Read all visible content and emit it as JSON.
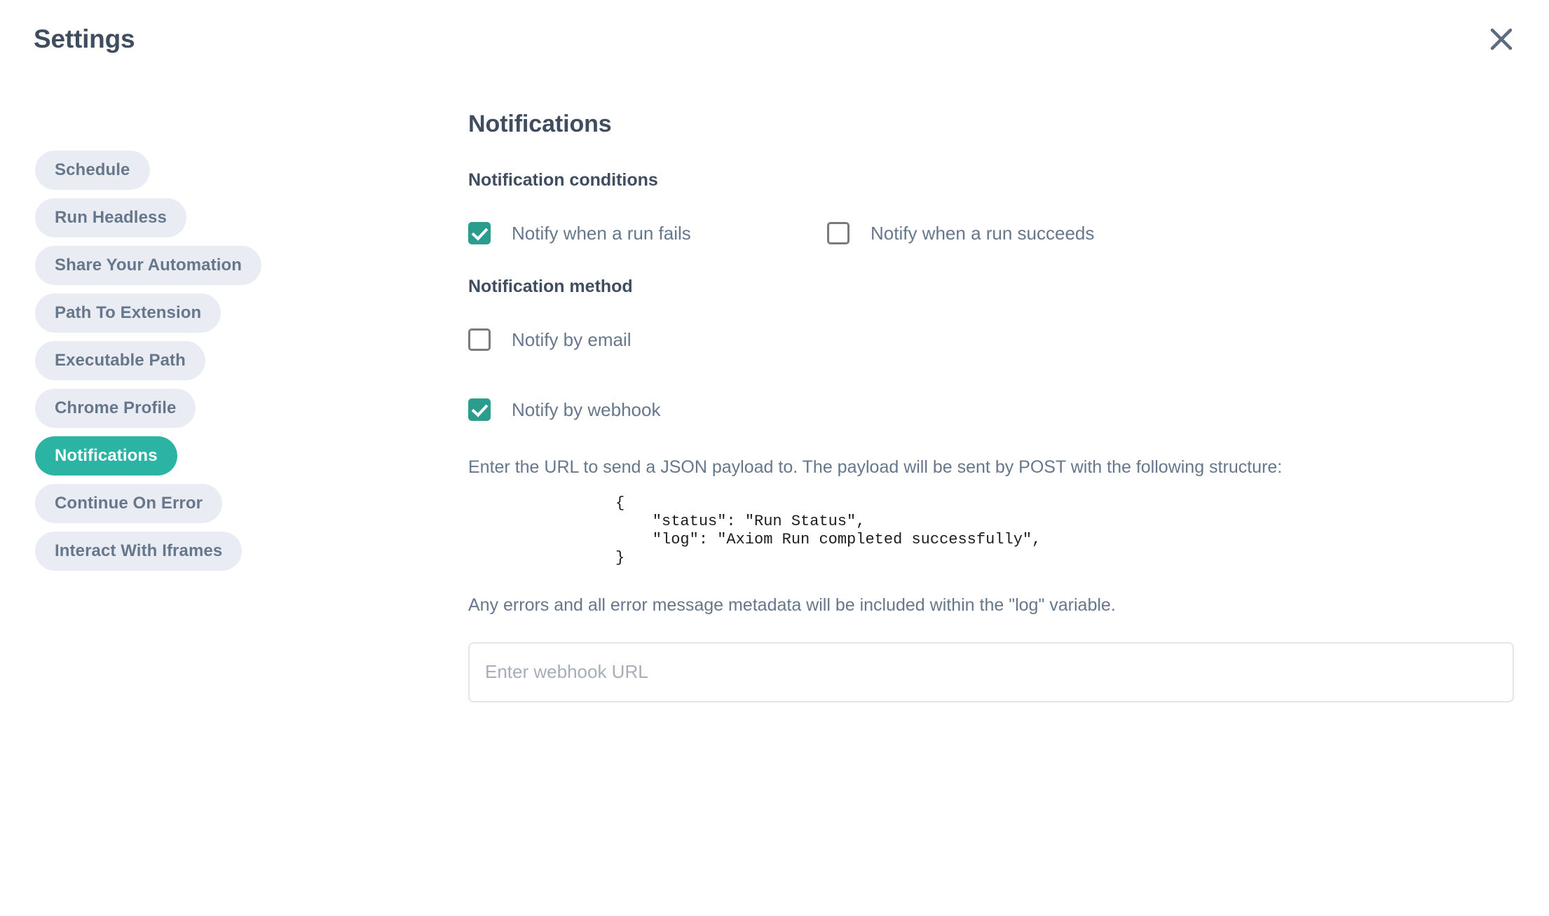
{
  "header": {
    "title": "Settings",
    "close_icon": "close-icon"
  },
  "sidebar": {
    "items": [
      {
        "label": "Schedule",
        "active": false
      },
      {
        "label": "Run Headless",
        "active": false
      },
      {
        "label": "Share Your Automation",
        "active": false
      },
      {
        "label": "Path To Extension",
        "active": false
      },
      {
        "label": "Executable Path",
        "active": false
      },
      {
        "label": "Chrome Profile",
        "active": false
      },
      {
        "label": "Notifications",
        "active": true
      },
      {
        "label": "Continue On Error",
        "active": false
      },
      {
        "label": "Interact With Iframes",
        "active": false
      }
    ]
  },
  "content": {
    "title": "Notifications",
    "conditions": {
      "label": "Notification conditions",
      "options": [
        {
          "label": "Notify when a run fails",
          "checked": true
        },
        {
          "label": "Notify when a run succeeds",
          "checked": false
        }
      ]
    },
    "method": {
      "label": "Notification method",
      "email": {
        "label": "Notify by email",
        "checked": false
      },
      "webhook": {
        "label": "Notify by webhook",
        "checked": true
      }
    },
    "webhook_help": "Enter the URL to send a JSON payload to. The payload will be sent by POST with the following structure:",
    "payload_example": "{\n    \"status\": \"Run Status\",\n    \"log\": \"Axiom Run completed successfully\",\n}",
    "webhook_note": "Any errors and all error message metadata will be included within the \"log\" variable.",
    "webhook_input_placeholder": "Enter webhook URL",
    "webhook_input_value": ""
  },
  "colors": {
    "accent_teal": "#2a9d8f",
    "pill_active": "#2bb3a3",
    "pill_bg": "#e9edf3",
    "text_dark": "#3f4d5e",
    "text_muted": "#67778b"
  }
}
